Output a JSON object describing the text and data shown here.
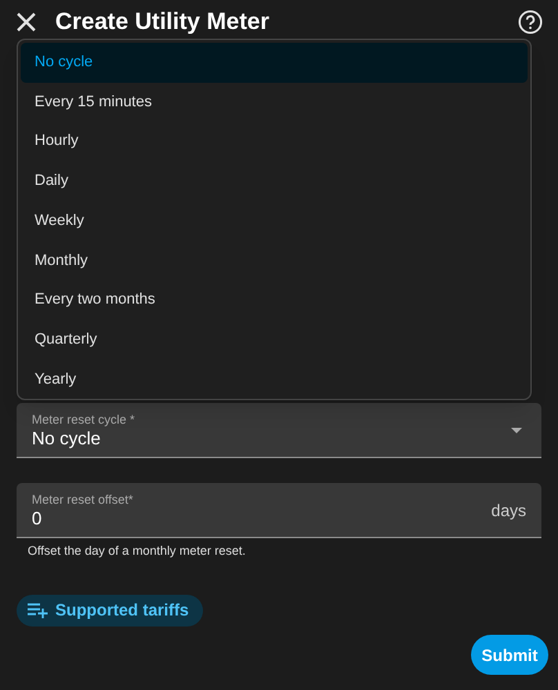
{
  "dialog": {
    "title": "Create Utility Meter"
  },
  "menu": {
    "items": [
      {
        "label": "No cycle",
        "selected": true
      },
      {
        "label": "Every 15 minutes",
        "selected": false
      },
      {
        "label": "Hourly",
        "selected": false
      },
      {
        "label": "Daily",
        "selected": false
      },
      {
        "label": "Weekly",
        "selected": false
      },
      {
        "label": "Monthly",
        "selected": false
      },
      {
        "label": "Every two months",
        "selected": false
      },
      {
        "label": "Quarterly",
        "selected": false
      },
      {
        "label": "Yearly",
        "selected": false
      }
    ]
  },
  "reset_cycle": {
    "label": "Meter reset cycle *",
    "value": "No cycle"
  },
  "reset_offset": {
    "label": "Meter reset offset*",
    "value": "0",
    "suffix": "days",
    "helper": "Offset the day of a monthly meter reset."
  },
  "tariffs_button": "Supported tariffs",
  "submit_button": "Submit"
}
